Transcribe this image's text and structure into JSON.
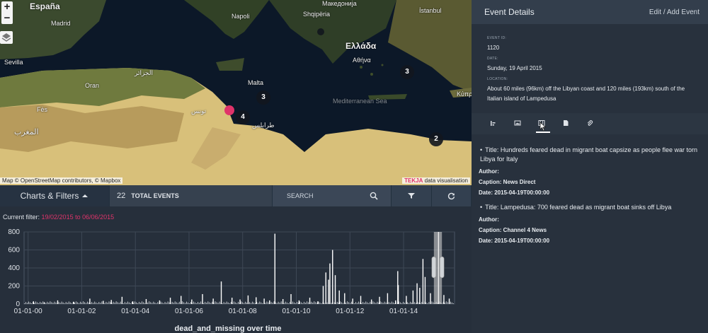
{
  "map": {
    "zoom_in": "+",
    "zoom_out": "−",
    "labels": {
      "espana": "España",
      "madrid": "Madrid",
      "sevilla": "Sevilla",
      "napoli": "Napoli",
      "shqiperia": "Shqipëria",
      "makedonija": "Македонија",
      "istanbul": "İstanbul",
      "ellada": "Ελλάδα",
      "athina": "Αθήνα",
      "malta": "Malta",
      "tunis": "تونس",
      "oran": "Oran",
      "fes": "Fès",
      "maghrib": "المغرب",
      "tarabulus": "طرابلس",
      "kypros": "Κύπρ",
      "jazair": "الجزائر",
      "mediterranean": "Mediterranean Sea"
    },
    "clusters": [
      "3",
      "3",
      "4",
      "2"
    ],
    "attribution": "Map © OpenStreetMap contributors, © Mapbox",
    "brand_name": "TEKJA",
    "brand_suffix": "data visualisation"
  },
  "toolbar": {
    "title": "Charts & Filters",
    "total_count": "22",
    "total_label": "TOTAL EVENTS",
    "search_placeholder": "SEARCH",
    "icons": [
      "search-icon",
      "filter-icon",
      "refresh-icon"
    ]
  },
  "filter": {
    "label": "Current filter:",
    "value": "19/02/2015 to 06/06/2015"
  },
  "chart_data": {
    "type": "bar",
    "xlabel": "dead_and_missing over time",
    "ylabel": "",
    "ylim": [
      0,
      800
    ],
    "y_ticks": [
      "0",
      "200",
      "400",
      "600",
      "800"
    ],
    "x_ticks": [
      "01-01-00",
      "01-01-02",
      "01-01-04",
      "01-01-06",
      "01-01-08",
      "01-01-10",
      "01-01-12",
      "01-01-14"
    ],
    "x_tick_years": [
      2000,
      2002,
      2004,
      2006,
      2008,
      2010,
      2012,
      2014
    ],
    "x_range_years": [
      1999.85,
      2015.9
    ],
    "grid": true,
    "brush": {
      "from": "19/02/2015",
      "to": "06/06/2015",
      "from_year": 2015.13,
      "to_year": 2015.43
    },
    "points": [
      {
        "x": 2000.2,
        "y": 30
      },
      {
        "x": 2000.6,
        "y": 20
      },
      {
        "x": 2001.1,
        "y": 40
      },
      {
        "x": 2001.7,
        "y": 25
      },
      {
        "x": 2002.3,
        "y": 60
      },
      {
        "x": 2002.8,
        "y": 35
      },
      {
        "x": 2003.1,
        "y": 45
      },
      {
        "x": 2003.5,
        "y": 80
      },
      {
        "x": 2003.9,
        "y": 30
      },
      {
        "x": 2004.4,
        "y": 55
      },
      {
        "x": 2004.9,
        "y": 40
      },
      {
        "x": 2005.3,
        "y": 70
      },
      {
        "x": 2005.7,
        "y": 90
      },
      {
        "x": 2006.1,
        "y": 50
      },
      {
        "x": 2006.5,
        "y": 110
      },
      {
        "x": 2006.9,
        "y": 60
      },
      {
        "x": 2007.2,
        "y": 250
      },
      {
        "x": 2007.6,
        "y": 70
      },
      {
        "x": 2007.9,
        "y": 50
      },
      {
        "x": 2008.2,
        "y": 95
      },
      {
        "x": 2008.5,
        "y": 75
      },
      {
        "x": 2008.8,
        "y": 60
      },
      {
        "x": 2009.0,
        "y": 40
      },
      {
        "x": 2009.2,
        "y": 780
      },
      {
        "x": 2009.5,
        "y": 55
      },
      {
        "x": 2009.8,
        "y": 110
      },
      {
        "x": 2010.1,
        "y": 40
      },
      {
        "x": 2010.5,
        "y": 70
      },
      {
        "x": 2010.8,
        "y": 30
      },
      {
        "x": 2011.0,
        "y": 200
      },
      {
        "x": 2011.1,
        "y": 350
      },
      {
        "x": 2011.2,
        "y": 270
      },
      {
        "x": 2011.25,
        "y": 450
      },
      {
        "x": 2011.35,
        "y": 600
      },
      {
        "x": 2011.45,
        "y": 320
      },
      {
        "x": 2011.6,
        "y": 150
      },
      {
        "x": 2011.8,
        "y": 120
      },
      {
        "x": 2012.1,
        "y": 60
      },
      {
        "x": 2012.4,
        "y": 90
      },
      {
        "x": 2012.8,
        "y": 50
      },
      {
        "x": 2013.1,
        "y": 80
      },
      {
        "x": 2013.4,
        "y": 120
      },
      {
        "x": 2013.7,
        "y": 40
      },
      {
        "x": 2013.78,
        "y": 365
      },
      {
        "x": 2013.8,
        "y": 210
      },
      {
        "x": 2014.1,
        "y": 90
      },
      {
        "x": 2014.35,
        "y": 150
      },
      {
        "x": 2014.5,
        "y": 230
      },
      {
        "x": 2014.6,
        "y": 180
      },
      {
        "x": 2014.72,
        "y": 500
      },
      {
        "x": 2014.8,
        "y": 300
      },
      {
        "x": 2015.0,
        "y": 120
      },
      {
        "x": 2015.3,
        "y": 800
      },
      {
        "x": 2015.5,
        "y": 100
      },
      {
        "x": 2015.7,
        "y": 60
      }
    ]
  },
  "panel": {
    "title": "Event Details",
    "edit_link": "Edit / Add Event",
    "event_id_label": "EVENT ID:",
    "event_id": "1120",
    "date_label": "DATE:",
    "date": "Sunday, 19 April 2015",
    "location_label": "LOCATION:",
    "location": "About 60 miles (96km) off the Libyan coast and 120 miles (193km) south of the Italian island of Lampedusa",
    "tabs": [
      "chart-tab",
      "image-tab",
      "media-tab",
      "document-tab",
      "link-tab"
    ],
    "media": [
      {
        "title": "Title: Hundreds feared dead in migrant boat capsize as people flee war torn Libya for Italy",
        "author": "Author:",
        "caption": "Caption: News Direct",
        "date": "Date: 2015-04-19T00:00:00"
      },
      {
        "title": "Title: Lampedusa: 700 feared dead as migrant boat sinks off Libya",
        "author": "Author:",
        "caption": "Caption: Channel 4 News",
        "date": "Date: 2015-04-19T00:00:00"
      }
    ]
  }
}
